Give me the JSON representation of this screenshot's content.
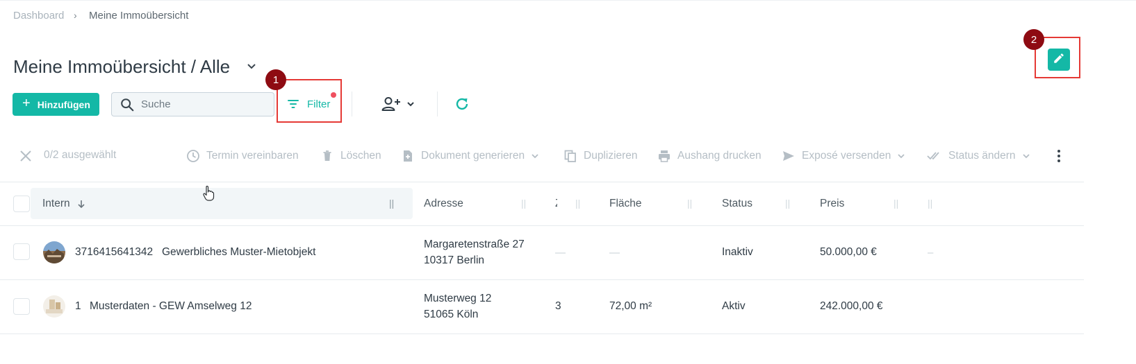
{
  "breadcrumb": {
    "home": "Dashboard",
    "separator": "›",
    "current": "Meine Immoübersicht"
  },
  "page": {
    "title": "Meine Immoübersicht / Alle"
  },
  "callouts": {
    "filter_badge": "1",
    "edit_badge": "2"
  },
  "toolbar": {
    "add_label": "Hinzufügen",
    "search_placeholder": "Suche",
    "filter_label": "Filter"
  },
  "actions": {
    "selected": "0/2 ausgewählt",
    "appointment": "Termin vereinbaren",
    "delete": "Löschen",
    "generate_document": "Dokument generieren",
    "duplicate": "Duplizieren",
    "print_notice": "Aushang drucken",
    "send_expose": "Exposé versenden",
    "change_status": "Status ändern"
  },
  "table": {
    "headers": {
      "intern": "Intern",
      "address": "Adresse",
      "rooms_truncated": "Z",
      "area": "Fläche",
      "status": "Status",
      "price": "Preis"
    },
    "rows": [
      {
        "id": "3716415641342",
        "name": "Gewerbliches Muster-Mietobjekt",
        "address_line1": "Margaretenstraße 27",
        "address_line2": "10317 Berlin",
        "rooms": "—",
        "area": "—",
        "status": "Inaktiv",
        "price": "50.000,00 €",
        "extra": "–"
      },
      {
        "id": "1",
        "name": "Musterdaten - GEW Amselweg 12",
        "address_line1": "Musterweg 12",
        "address_line2": "51065 Köln",
        "rooms": "3",
        "area": "72,00 m²",
        "status": "Aktiv",
        "price": "242.000,00 €",
        "extra": ""
      }
    ]
  },
  "colors": {
    "accent": "#14b8a6",
    "highlight": "#e53935",
    "badge": "#8e0b12",
    "notification_dot": "#ef4f5f"
  }
}
